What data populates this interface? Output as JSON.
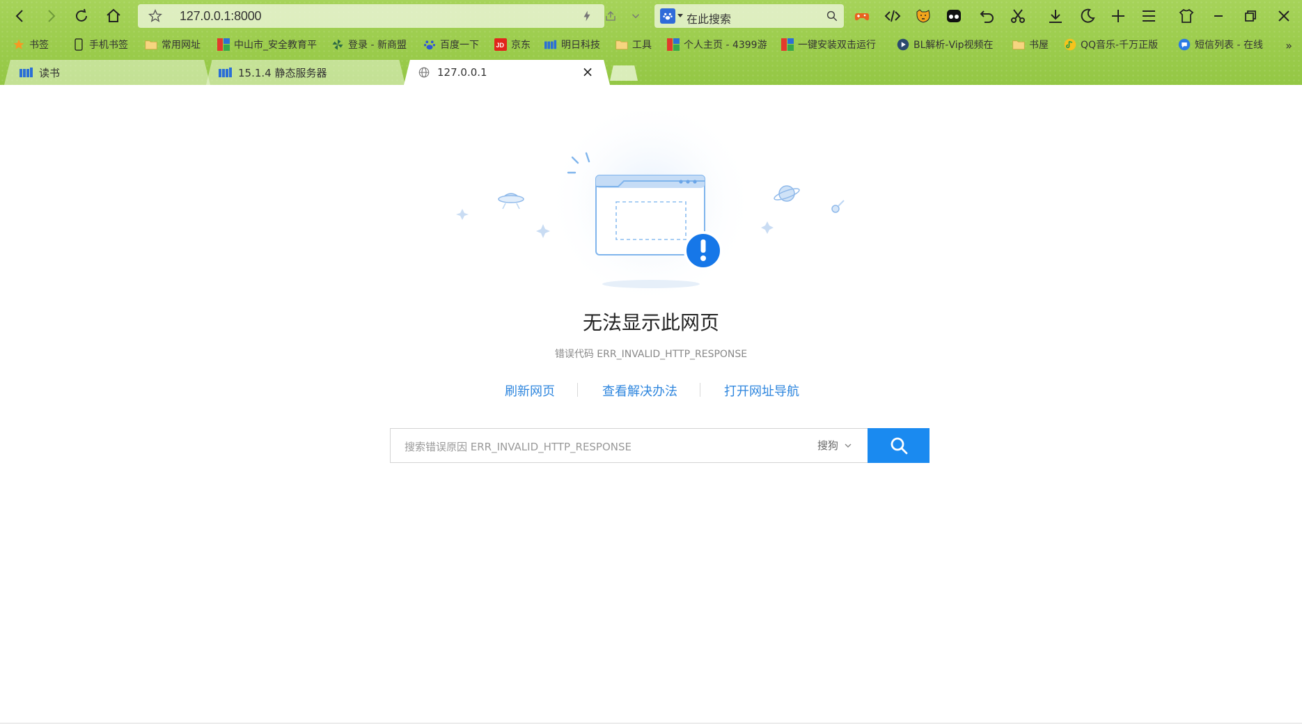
{
  "browser": {
    "address_url": "127.0.0.1:8000",
    "search_placeholder": "在此搜索",
    "bookmarks": [
      {
        "label": "书签",
        "icon": "star-icon"
      },
      {
        "label": "手机书签",
        "icon": "phone-icon"
      },
      {
        "label": "常用网址",
        "icon": "folder-icon"
      },
      {
        "label": "中山市_安全教育平",
        "icon": "site-color-icon"
      },
      {
        "label": "登录 - 新商盟",
        "icon": "pinwheel-icon"
      },
      {
        "label": "百度一下",
        "icon": "baidu-paw-icon"
      },
      {
        "label": "京东",
        "icon": "jd-icon"
      },
      {
        "label": "明日科技",
        "icon": "mr-logo-icon"
      },
      {
        "label": "工具",
        "icon": "folder-icon"
      },
      {
        "label": "个人主页 - 4399游",
        "icon": "site-color-icon"
      },
      {
        "label": "一键安装双击运行",
        "icon": "site-color-icon"
      },
      {
        "label": "BL解析-Vip视频在",
        "icon": "play-icon"
      },
      {
        "label": "书屋",
        "icon": "folder-icon"
      },
      {
        "label": "QQ音乐-千万正版",
        "icon": "qq-music-icon"
      },
      {
        "label": "短信列表 - 在线",
        "icon": "message-icon"
      }
    ],
    "bookmarks_more": "»",
    "tabs": [
      {
        "title": "读书",
        "icon": "mr-logo-icon",
        "active": false
      },
      {
        "title": "15.1.4 静态服务器",
        "icon": "mr-logo-icon",
        "active": false
      },
      {
        "title": "127.0.0.1",
        "icon": "globe-icon",
        "active": true
      }
    ],
    "tab_close": "×"
  },
  "error_page": {
    "title": "无法显示此网页",
    "code_line": "错误代码 ERR_INVALID_HTTP_RESPONSE",
    "links": {
      "refresh": "刷新网页",
      "solutions": "查看解决办法",
      "navigation": "打开网址导航"
    },
    "search": {
      "placeholder": "搜索错误原因 ERR_INVALID_HTTP_RESPONSE",
      "engine": "搜狗"
    }
  },
  "colors": {
    "chrome_green": "#9bcc4c",
    "link_blue": "#2e86de",
    "search_button": "#1a8af0",
    "alert_blue": "#1677e8"
  }
}
